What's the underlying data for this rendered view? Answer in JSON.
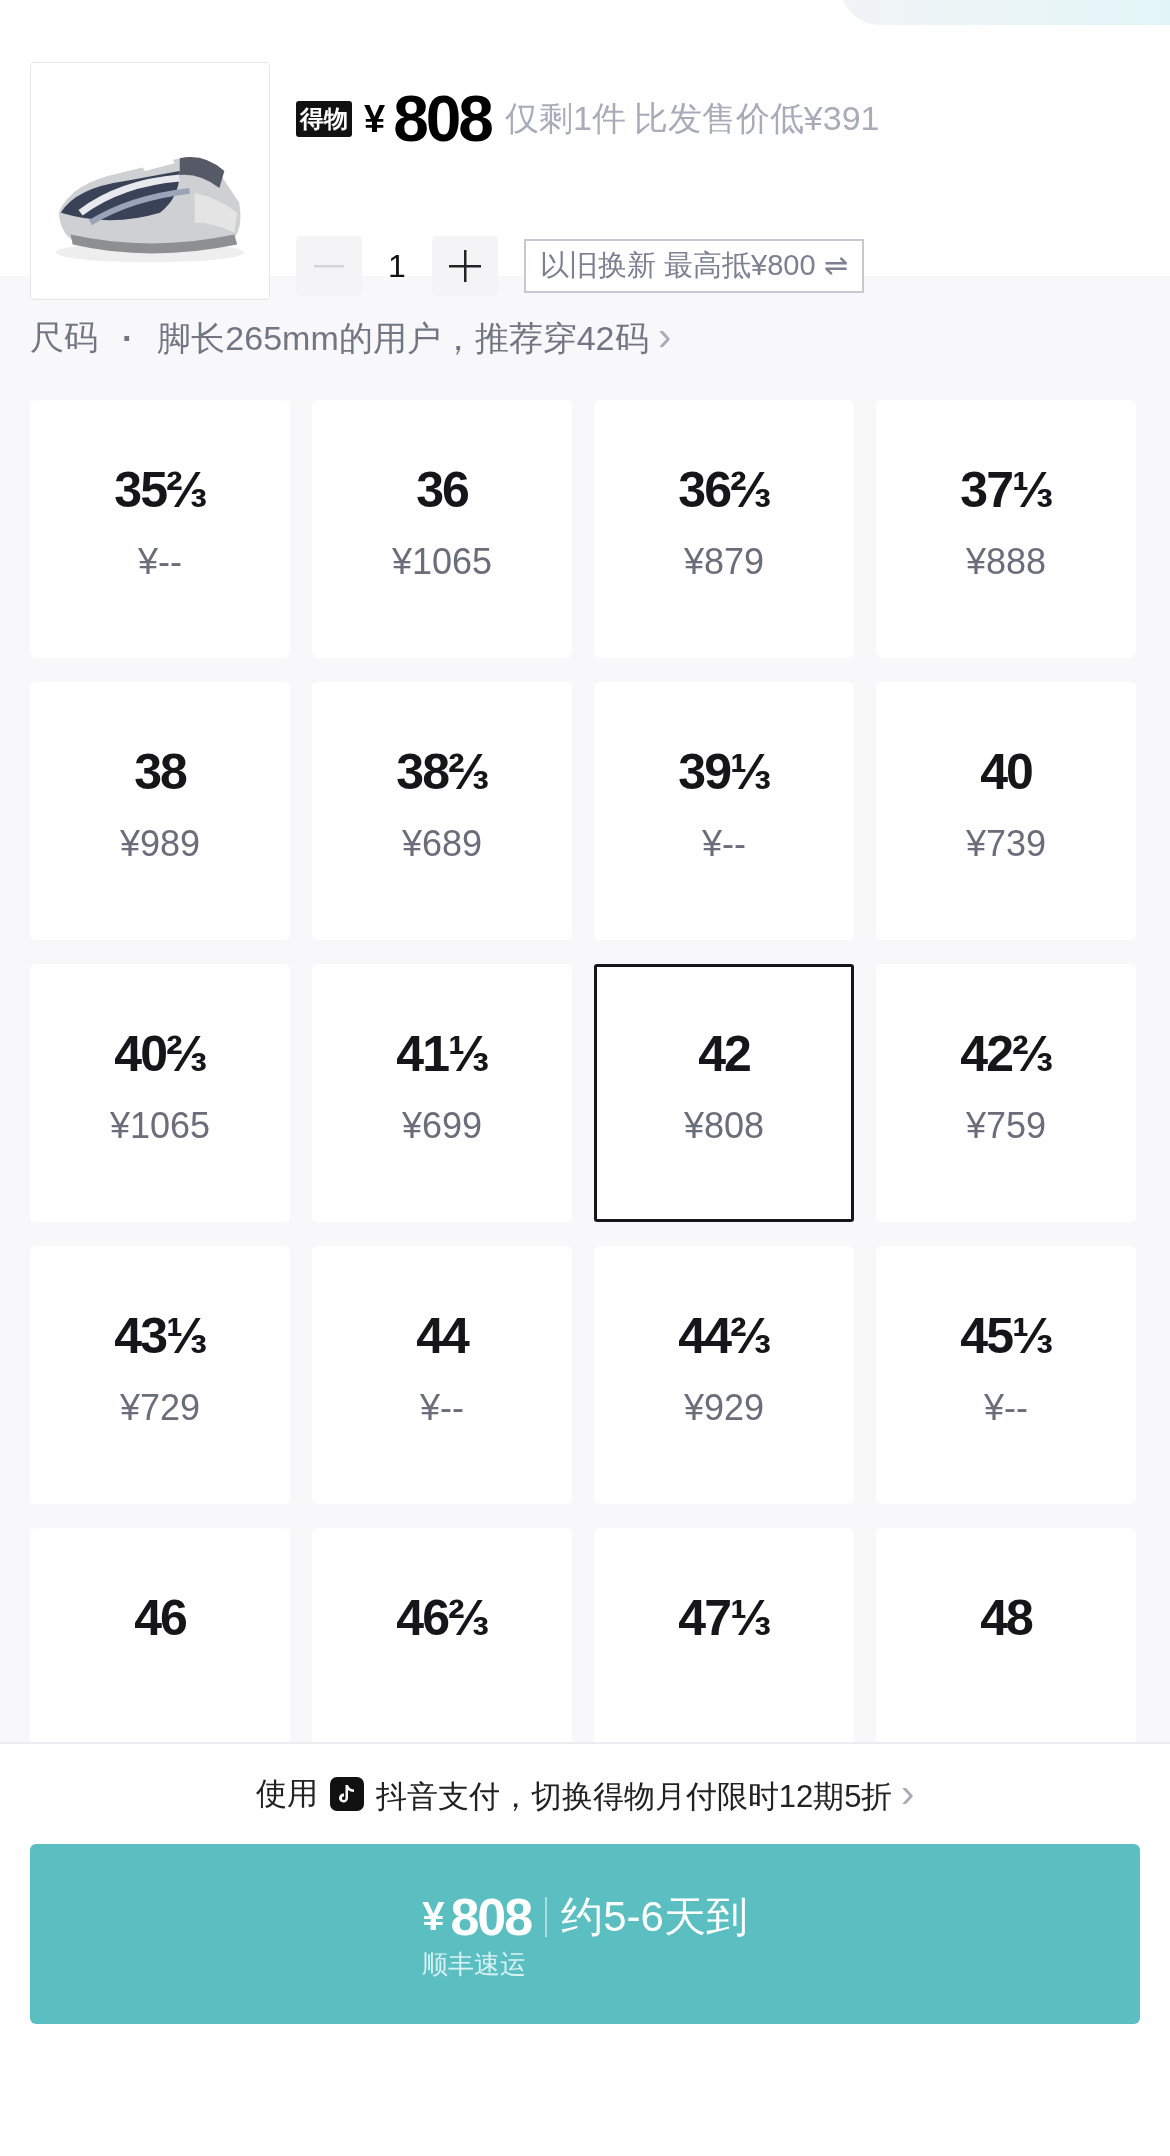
{
  "product": {
    "brand_badge": "得物",
    "currency": "¥",
    "price": "808",
    "stock_note": "仅剩1件",
    "discount_note": "比发售价低¥391",
    "quantity": "1",
    "decrease_disabled": true,
    "trade_in": "以旧换新 最高抵¥800 ⇌"
  },
  "size_header": {
    "label": "尺码",
    "separator": "·",
    "recommendation": "脚长265mm的用户，推荐穿42码",
    "chevron": "›"
  },
  "sizes": [
    {
      "size": "35⅔",
      "price": "¥--",
      "selected": false
    },
    {
      "size": "36",
      "price": "¥1065",
      "selected": false
    },
    {
      "size": "36⅔",
      "price": "¥879",
      "selected": false
    },
    {
      "size": "37⅓",
      "price": "¥888",
      "selected": false
    },
    {
      "size": "38",
      "price": "¥989",
      "selected": false
    },
    {
      "size": "38⅔",
      "price": "¥689",
      "selected": false
    },
    {
      "size": "39⅓",
      "price": "¥--",
      "selected": false
    },
    {
      "size": "40",
      "price": "¥739",
      "selected": false
    },
    {
      "size": "40⅔",
      "price": "¥1065",
      "selected": false
    },
    {
      "size": "41⅓",
      "price": "¥699",
      "selected": false
    },
    {
      "size": "42",
      "price": "¥808",
      "selected": true
    },
    {
      "size": "42⅔",
      "price": "¥759",
      "selected": false
    },
    {
      "size": "43⅓",
      "price": "¥729",
      "selected": false
    },
    {
      "size": "44",
      "price": "¥--",
      "selected": false
    },
    {
      "size": "44⅔",
      "price": "¥929",
      "selected": false
    },
    {
      "size": "45⅓",
      "price": "¥--",
      "selected": false
    },
    {
      "size": "46",
      "selected": false
    },
    {
      "size": "46⅔",
      "selected": false
    },
    {
      "size": "47⅓",
      "selected": false
    },
    {
      "size": "48",
      "selected": false
    }
  ],
  "payment_note": {
    "prefix": "使用",
    "text": "抖音支付，切换得物月付限时12期5折",
    "chevron": "›"
  },
  "buy_button": {
    "currency": "¥",
    "price": "808",
    "delivery": "约5-6天到",
    "shipping": "顺丰速运"
  }
}
